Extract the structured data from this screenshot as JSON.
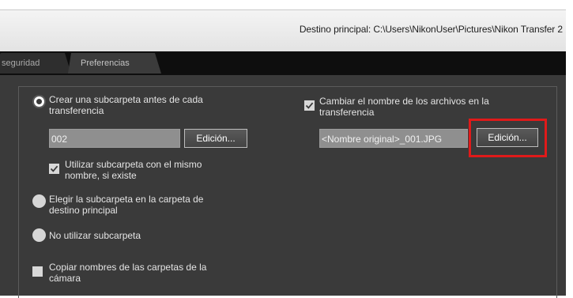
{
  "header": {
    "destination_text": "Destino principal: C:\\Users\\NikonUser\\Pictures\\Nikon Transfer 2"
  },
  "tabs": [
    {
      "label": "seguridad"
    },
    {
      "label": "Preferencias"
    }
  ],
  "left_options": {
    "create_subfolder": {
      "label_line1": "Crear una subcarpeta antes de cada",
      "label_line2": "transferencia",
      "selected": true
    },
    "subfolder_name": {
      "value": "002"
    },
    "edit_button_label": "Edición...",
    "use_existing": {
      "label_line1": "Utilizar subcarpeta con el mismo",
      "label_line2": "nombre, si existe",
      "checked": true
    },
    "choose_subfolder": {
      "label_line1": "Elegir la subcarpeta en la carpeta de",
      "label_line2": "destino principal",
      "selected": false
    },
    "no_subfolder": {
      "label": "No utilizar subcarpeta",
      "selected": false
    },
    "copy_camera_names": {
      "label_line1": "Copiar nombres de las carpetas de la",
      "label_line2": "cámara",
      "checked": false
    }
  },
  "right_options": {
    "rename_files": {
      "label_line1": "Cambiar el nombre de los archivos en la",
      "label_line2": "transferencia",
      "checked": true
    },
    "filename_pattern": {
      "value": "<Nombre original>_001.JPG"
    },
    "edit_button_label": "Edición..."
  },
  "colors": {
    "highlight": "#e01a1a",
    "panel_bg": "#3a3a3a",
    "tab_strip_bg": "#0e0e0e"
  }
}
